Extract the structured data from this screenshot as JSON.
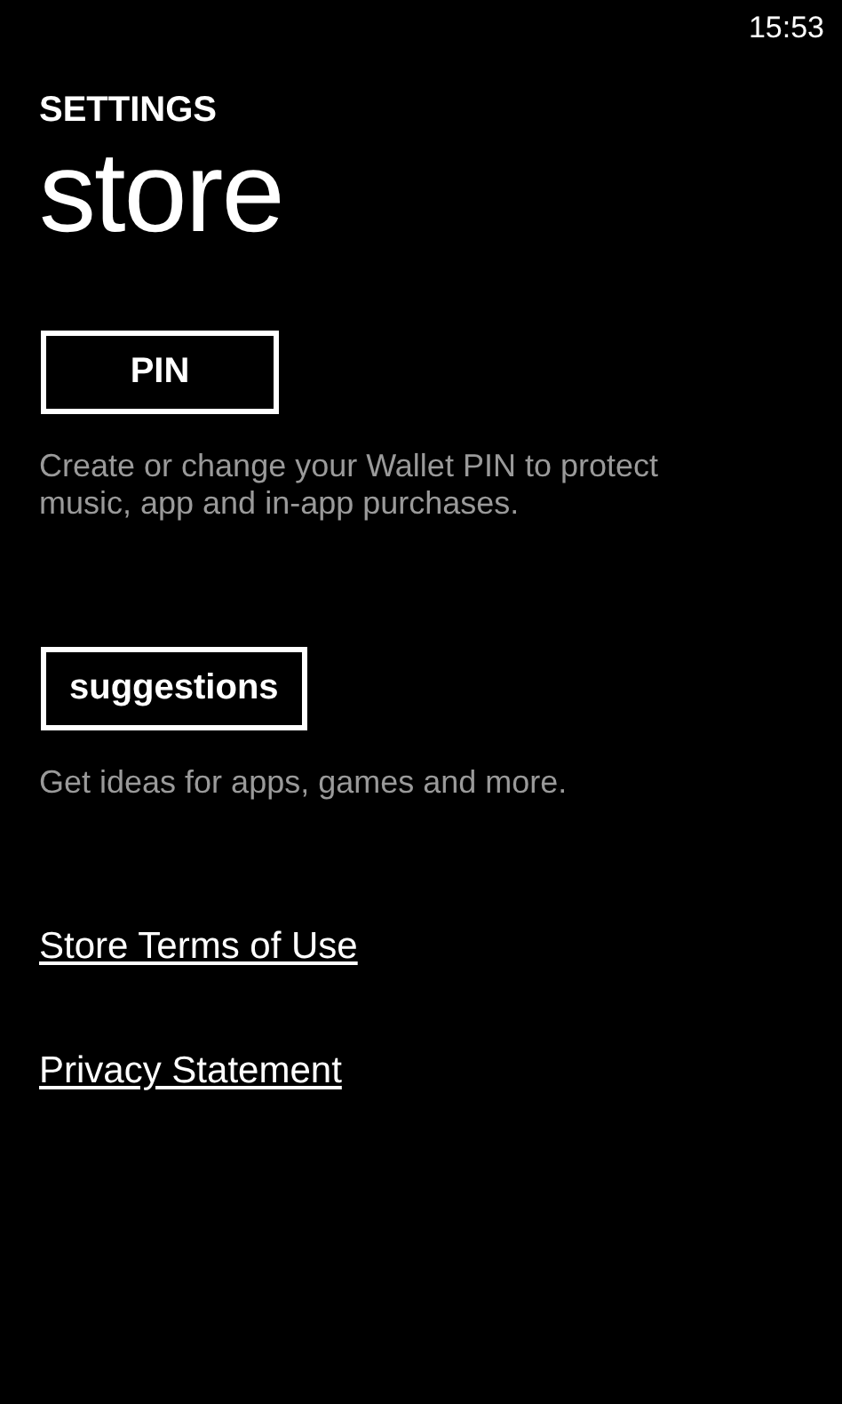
{
  "status_bar": {
    "time": "15:53"
  },
  "header": {
    "app_title": "SETTINGS",
    "page_title": "store"
  },
  "sections": [
    {
      "button": "PIN",
      "description": "Create or change your Wallet PIN to protect music, app and in-app purchases."
    },
    {
      "button": "suggestions",
      "description": "Get ideas for apps, games and more."
    }
  ],
  "links": [
    "Store Terms of Use",
    "Privacy Statement"
  ]
}
